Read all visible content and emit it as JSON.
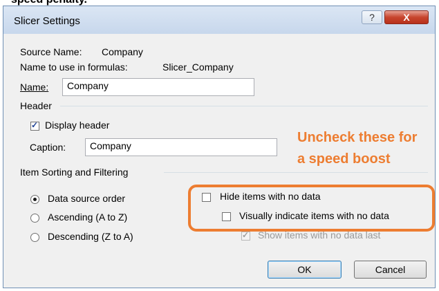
{
  "header_snippet": "speed penalty.",
  "window": {
    "title": "Slicer Settings",
    "help_label": "?",
    "close_label": "X"
  },
  "source_name": {
    "label": "Source Name:",
    "value": "Company"
  },
  "formula_name": {
    "label": "Name to use in formulas:",
    "value": "Slicer_Company"
  },
  "name_field": {
    "label": "Name:",
    "value": "Company"
  },
  "header_section": {
    "title": "Header",
    "display_header": {
      "label": "Display header",
      "checked": true
    },
    "caption": {
      "label": "Caption:",
      "value": "Company"
    }
  },
  "sorting_section": {
    "title": "Item Sorting and Filtering",
    "options": [
      {
        "label": "Data source order",
        "selected": true
      },
      {
        "label": "Ascending (A to Z)",
        "selected": false
      },
      {
        "label": "Descending (Z to A)",
        "selected": false
      }
    ],
    "hide_items": {
      "label": "Hide items with no data",
      "checked": false
    },
    "visually_indicate": {
      "label": "Visually indicate items with no data",
      "checked": false
    },
    "show_last": {
      "label": "Show items with no data last",
      "checked": true,
      "disabled": true
    }
  },
  "callout": {
    "line1": "Uncheck these for",
    "line2": "a speed boost",
    "color": "#ed7d31"
  },
  "buttons": {
    "ok": "OK",
    "cancel": "Cancel"
  }
}
